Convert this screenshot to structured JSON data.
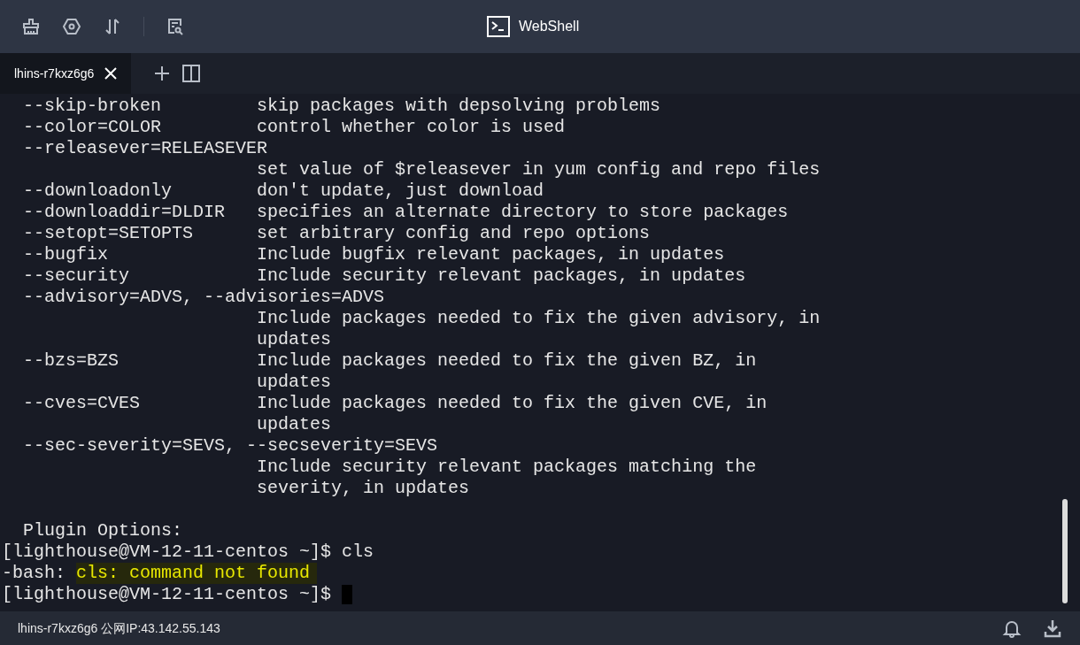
{
  "toolbar": {
    "title": "WebShell"
  },
  "tabs": [
    {
      "label": "lhins-r7kxz6g6",
      "selected": true
    }
  ],
  "terminal": {
    "lines": [
      {
        "kind": "plain",
        "text": "  --skip-broken         skip packages with depsolving problems"
      },
      {
        "kind": "plain",
        "text": "  --color=COLOR         control whether color is used"
      },
      {
        "kind": "plain",
        "text": "  --releasever=RELEASEVER"
      },
      {
        "kind": "plain",
        "text": "                        set value of $releasever in yum config and repo files"
      },
      {
        "kind": "plain",
        "text": "  --downloadonly        don't update, just download"
      },
      {
        "kind": "plain",
        "text": "  --downloaddir=DLDIR   specifies an alternate directory to store packages"
      },
      {
        "kind": "plain",
        "text": "  --setopt=SETOPTS      set arbitrary config and repo options"
      },
      {
        "kind": "plain",
        "text": "  --bugfix              Include bugfix relevant packages, in updates"
      },
      {
        "kind": "plain",
        "text": "  --security            Include security relevant packages, in updates"
      },
      {
        "kind": "plain",
        "text": "  --advisory=ADVS, --advisories=ADVS"
      },
      {
        "kind": "plain",
        "text": "                        Include packages needed to fix the given advisory, in"
      },
      {
        "kind": "plain",
        "text": "                        updates"
      },
      {
        "kind": "plain",
        "text": "  --bzs=BZS             Include packages needed to fix the given BZ, in"
      },
      {
        "kind": "plain",
        "text": "                        updates"
      },
      {
        "kind": "plain",
        "text": "  --cves=CVES           Include packages needed to fix the given CVE, in"
      },
      {
        "kind": "plain",
        "text": "                        updates"
      },
      {
        "kind": "plain",
        "text": "  --sec-severity=SEVS, --secseverity=SEVS"
      },
      {
        "kind": "plain",
        "text": "                        Include security relevant packages matching the"
      },
      {
        "kind": "plain",
        "text": "                        severity, in updates"
      },
      {
        "kind": "blank"
      },
      {
        "kind": "plain",
        "text": "  Plugin Options:"
      },
      {
        "kind": "plain",
        "text": "[lighthouse@VM-12-11-centos ~]$ cls"
      },
      {
        "kind": "error",
        "prefix": "-bash: ",
        "message": "cls: command not found"
      },
      {
        "kind": "prompt",
        "text": "[lighthouse@VM-12-11-centos ~]$ ",
        "cursor": true
      }
    ]
  },
  "status_bar": {
    "text": "lhins-r7kxz6g6 公网IP:43.142.55.143"
  }
}
